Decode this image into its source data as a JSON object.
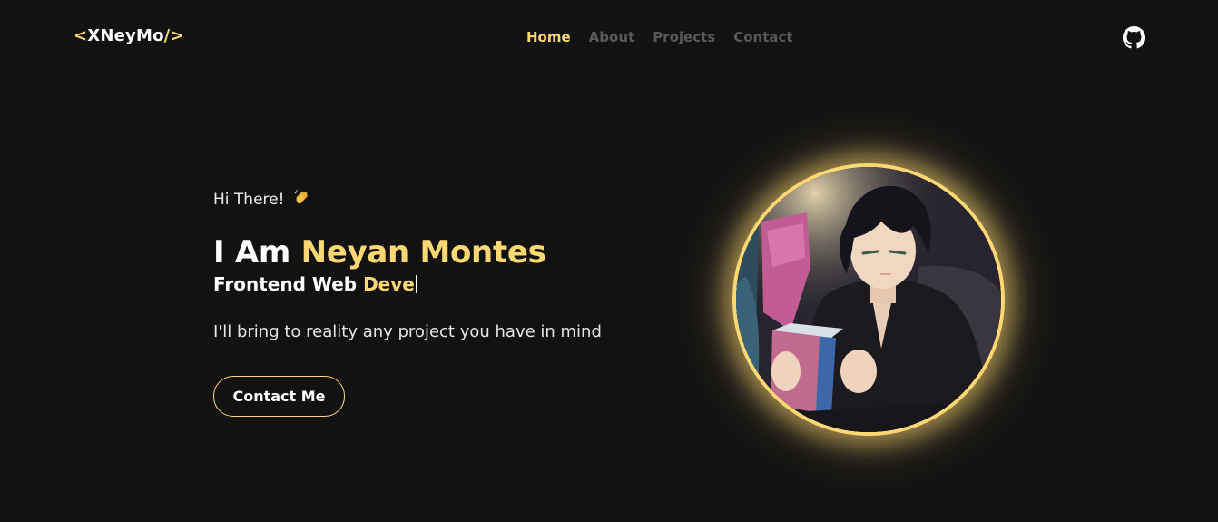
{
  "navbar": {
    "logo": {
      "open": "<",
      "name": "XNeyMo",
      "close": "/>"
    },
    "links": [
      {
        "label": "Home",
        "active": true
      },
      {
        "label": "About",
        "active": false
      },
      {
        "label": "Projects",
        "active": false
      },
      {
        "label": "Contact",
        "active": false
      }
    ],
    "github_icon": "github-icon"
  },
  "hero": {
    "greeting": "Hi There!",
    "wave_icon": "waving-hand-icon",
    "name_prefix": "I Am",
    "name": "Neyan Montes",
    "role_prefix": "Frontend Web",
    "role_typed": "Deve",
    "tagline": "I'll bring to reality any project you have in mind",
    "cta_label": "Contact Me"
  },
  "avatar": {
    "description_icon": "avatar-illustration"
  },
  "colors": {
    "background": "#121212",
    "accent": "#ffd873",
    "nav_inactive": "#595959",
    "text": "#ffffff"
  }
}
